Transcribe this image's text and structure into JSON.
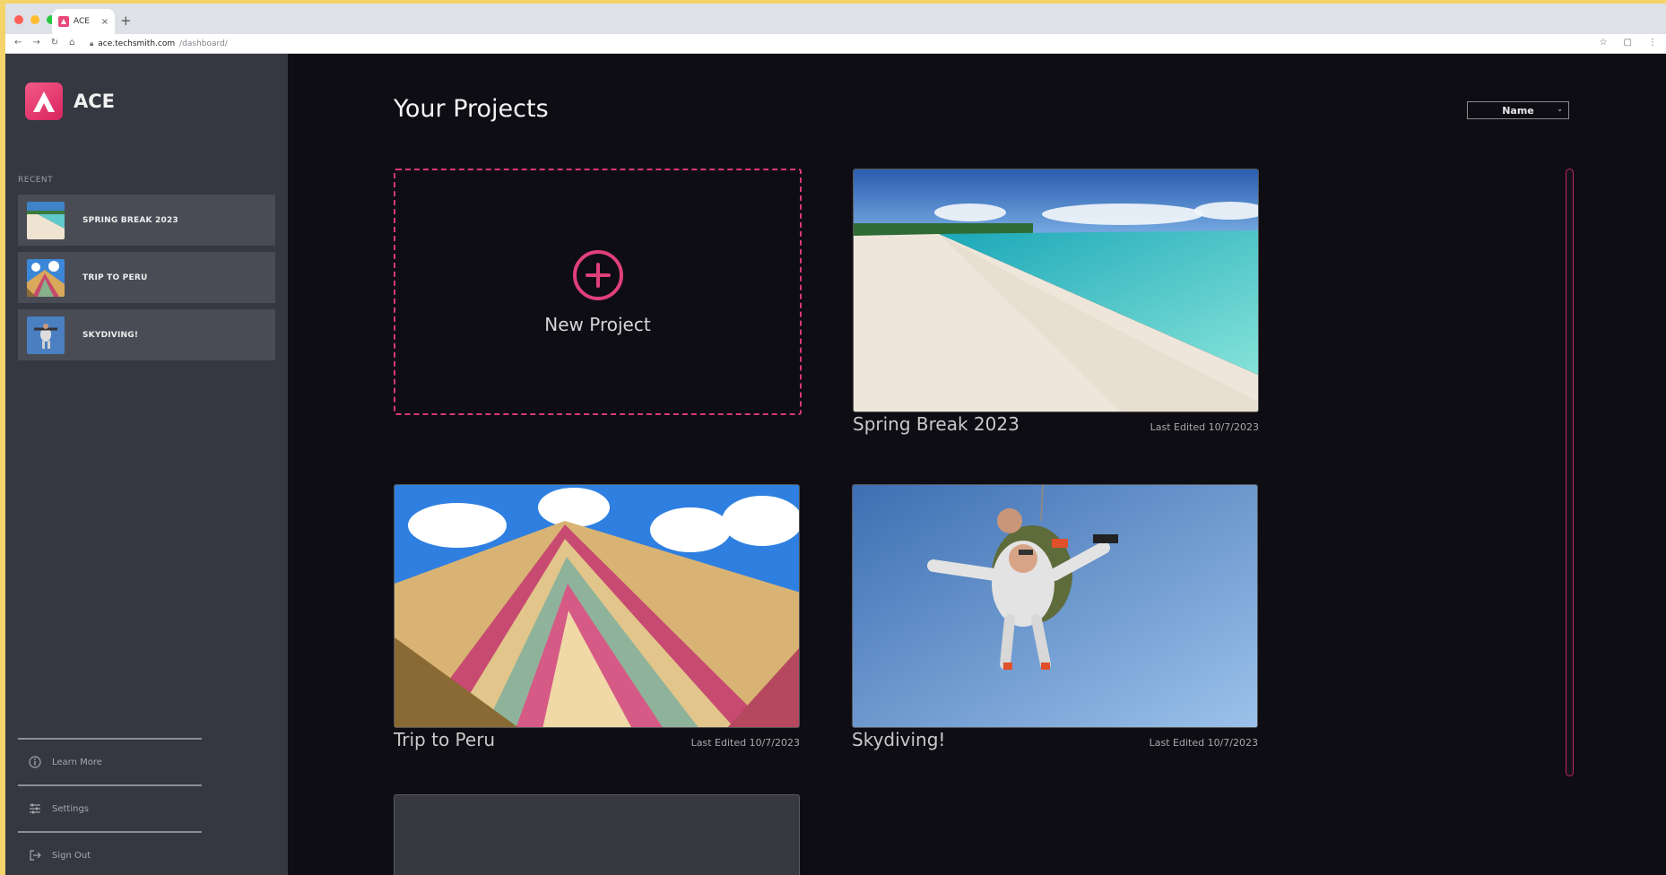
{
  "browser": {
    "tab_title": "ACE",
    "tab_close": "×",
    "new_tab": "+",
    "url_host": "ace.techsmith.com",
    "url_path": "/dashboard/"
  },
  "app": {
    "brand": "ACE",
    "accent": "#e8477a"
  },
  "sidebar": {
    "recent_label": "RECENT",
    "recent": [
      {
        "label": "SPRING BREAK 2023"
      },
      {
        "label": "TRIP TO PERU"
      },
      {
        "label": "SKYDIVING!"
      }
    ],
    "links": [
      {
        "label": "Learn More",
        "icon": "info-icon"
      },
      {
        "label": "Settings",
        "icon": "sliders-icon"
      },
      {
        "label": "Sign Out",
        "icon": "sign-out-icon"
      }
    ]
  },
  "main": {
    "title": "Your Projects",
    "sort": {
      "selected": "Name"
    },
    "new_project_label": "New Project",
    "projects": [
      {
        "name": "Spring Break 2023",
        "edited": "Last Edited 10/7/2023"
      },
      {
        "name": "Trip to Peru",
        "edited": "Last Edited 10/7/2023"
      },
      {
        "name": "Skydiving!",
        "edited": "Last Edited 10/7/2023"
      }
    ]
  }
}
